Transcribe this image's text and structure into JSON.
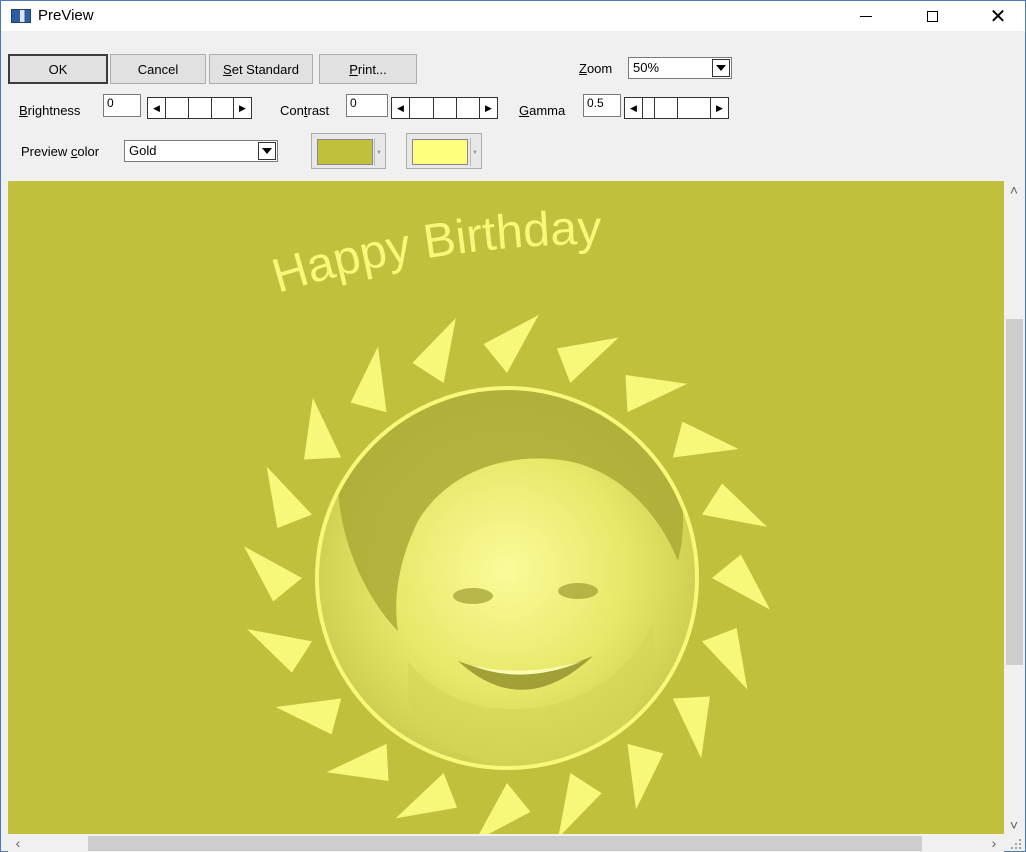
{
  "window": {
    "title": "PreView"
  },
  "toolbar": {
    "ok_label": "OK",
    "cancel_label": "Cancel",
    "set_standard": {
      "mnemonic": "S",
      "rest": "et Standard"
    },
    "print": {
      "mnemonic": "P",
      "rest": "rint..."
    },
    "zoom": {
      "mnemonic": "Z",
      "rest": "oom",
      "value": "50%"
    }
  },
  "adjustments": {
    "brightness": {
      "mnemonic": "B",
      "rest": "rightness",
      "value": "0",
      "level": 0.5
    },
    "contrast": {
      "pre": "Con",
      "mnemonic": "t",
      "rest": "rast",
      "value": "0",
      "level": 0.5
    },
    "gamma": {
      "mnemonic": "G",
      "rest": "amma",
      "value": "0.5",
      "level": 0.25
    }
  },
  "preview_color": {
    "pre": "Preview ",
    "mnemonic": "c",
    "rest": "olor",
    "value": "Gold",
    "swatch1": "#c0c03d",
    "swatch2": "#ffff80"
  },
  "card": {
    "text": "Happy  Birthday",
    "background": "#c0c03d",
    "ink": "#f7f77a"
  }
}
